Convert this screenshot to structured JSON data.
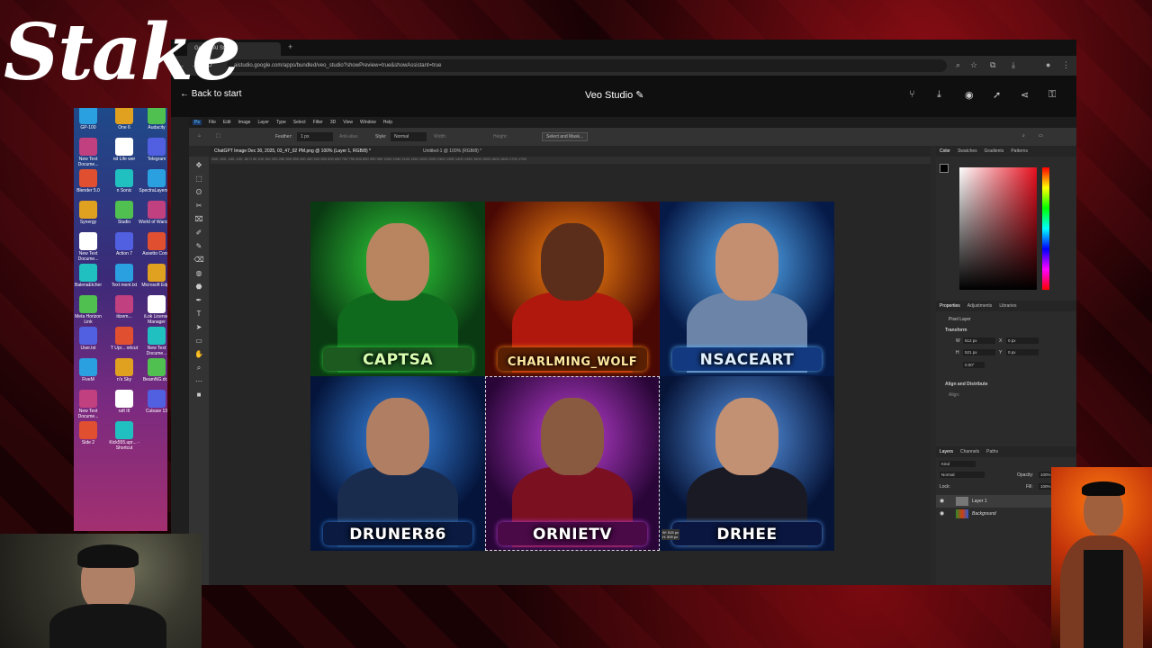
{
  "overlay": {
    "logo": "Stake"
  },
  "desktop_icons": [
    {
      "label": "GP-100",
      "x": 0
    },
    {
      "label": "One 6",
      "x": 0
    },
    {
      "label": "Audacity",
      "x": 0
    },
    {
      "label": "New Text Docume...",
      "x": 0
    },
    {
      "label": "nd Life wer",
      "x": 0
    },
    {
      "label": "Telegram",
      "x": 0
    },
    {
      "label": "Blender 5.0",
      "x": 0
    },
    {
      "label": "n Sonic",
      "x": 0
    },
    {
      "label": "SpectraLayers 10",
      "x": 0
    },
    {
      "label": "Synergy",
      "x": 0
    },
    {
      "label": "Studio",
      "x": 0
    },
    {
      "label": "World of Warcra...",
      "x": 0
    },
    {
      "label": "New Text Docume...",
      "x": 0
    },
    {
      "label": "Action 7",
      "x": 0
    },
    {
      "label": "Assetto Corsa",
      "x": 0
    },
    {
      "label": "BalenaEtcher",
      "x": 0
    },
    {
      "label": "Text ment.txt",
      "x": 0
    },
    {
      "label": "Microsoft Edge",
      "x": 0
    },
    {
      "label": "Meta Horizon Link",
      "x": 0
    },
    {
      "label": "itizem...",
      "x": 0
    },
    {
      "label": "iLok License Manager",
      "x": 0
    },
    {
      "label": "User.txt",
      "x": 0
    },
    {
      "label": "T Upr... ortcut",
      "x": 0
    },
    {
      "label": "New Text Docume...",
      "x": 0
    },
    {
      "label": "FiveM",
      "x": 0
    },
    {
      "label": "n's Sky",
      "x": 0
    },
    {
      "label": "BeamNG.dr...",
      "x": 0
    },
    {
      "label": "New Text Docume...",
      "x": 0
    },
    {
      "label": "raft III",
      "x": 0
    },
    {
      "label": "Cubase 13",
      "x": 0
    },
    {
      "label": "Side 2",
      "x": 0
    },
    {
      "label": "Kick555.upr... - Shortcut",
      "x": 0
    }
  ],
  "browser": {
    "tab_title": "Google AI Studio",
    "url": "aistudio.google.com/apps/bundled/veo_studio?showPreview=true&showAssistant=true",
    "back_label": "Back to start",
    "app_title": "Veo Studio"
  },
  "photoshop": {
    "menu": [
      "Ps",
      "File",
      "Edit",
      "Image",
      "Layer",
      "Type",
      "Select",
      "Filter",
      "3D",
      "View",
      "Window",
      "Help"
    ],
    "options": {
      "feather_label": "Feather:",
      "feather_value": "1 px",
      "antialias": "Anti-alias",
      "style_label": "Style:",
      "style_value": "Normal",
      "width_label": "Width:",
      "height_label": "Height:",
      "select_mask": "Select and Mask..."
    },
    "doc_tabs": [
      "ChatGPT Image Dec 30, 2025, 03_47_02 PM.png @ 100% (Layer 1, RGB/8) *",
      "Untitled-1 @ 100% (RGB/8) *"
    ],
    "ruler": "-250 -200 -150 -100 -50 0 50 100 150 200 250 300 350 400 450 500 550 600 650 700 750 800 850 900 950 1000 1050 1100 1150 1200 1250 1300 1350 1400 1450 1500 1550 1600 1650 1700 1750",
    "cards": [
      {
        "name": "CAPTSA",
        "bg1": "#0a3a12",
        "bg2": "#2fd13a",
        "face": "#b98561",
        "body": "#0f6a1e",
        "banner": "#1c5a20",
        "text": "#d8ffb0"
      },
      {
        "name": "CHARLMING_WOLF",
        "bg1": "#4a0804",
        "bg2": "#ff8a10",
        "face": "#5a2e1a",
        "body": "#b0180e",
        "banner": "#5a2004",
        "text": "#ffe8a0"
      },
      {
        "name": "NSACEART",
        "bg1": "#061a48",
        "bg2": "#58b4ff",
        "face": "#c48e70",
        "body": "#6c84a8",
        "banner": "#133a80",
        "text": "#e0f0ff"
      },
      {
        "name": "DRUNER86",
        "bg1": "#04143a",
        "bg2": "#3a8ae8",
        "face": "#b07e62",
        "body": "#1a2c4e",
        "banner": "#0a1a40",
        "text": "#ffffff"
      },
      {
        "name": "ORNIETV",
        "bg1": "#2a0638",
        "bg2": "#c040d8",
        "face": "#8a5a40",
        "body": "#7a1020",
        "banner": "#4a0a48",
        "text": "#ffffff"
      },
      {
        "name": "DRHEE",
        "bg1": "#061438",
        "bg2": "#5a9cf0",
        "face": "#c29072",
        "body": "#1a1a24",
        "banner": "#0a1640",
        "text": "#ffffff"
      }
    ],
    "size_tip": "W: 515 px\nH: 509 px",
    "color_tabs": [
      "Color",
      "Swatches",
      "Gradients",
      "Patterns"
    ],
    "props_tabs": [
      "Properties",
      "Adjustments",
      "Libraries"
    ],
    "props": {
      "kind": "Pixel Layer",
      "transform": "Transform",
      "w": "512 px",
      "h": "521 px",
      "x": "0 px",
      "y": "0 px",
      "angle": "0.00°",
      "align": "Align and Distribute",
      "align_sub": "Align:"
    },
    "layers_tabs": [
      "Layers",
      "Channels",
      "Paths"
    ],
    "layers": {
      "filter": "Kind",
      "blend": "Normal",
      "opacity_label": "Opacity:",
      "opacity": "100%",
      "lock_label": "Lock:",
      "fill_label": "Fill:",
      "fill": "100%",
      "items": [
        "Layer 1",
        "Background"
      ]
    }
  }
}
